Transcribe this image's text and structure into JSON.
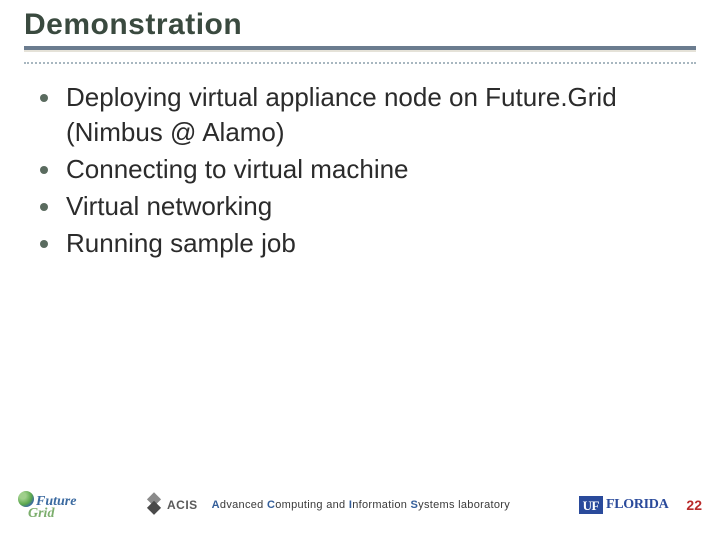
{
  "title": "Demonstration",
  "bullets": [
    "Deploying virtual appliance node on Future.Grid (Nimbus @ Alamo)",
    "Connecting to virtual machine",
    "Virtual networking",
    "Running sample job"
  ],
  "footer": {
    "futuregrid": {
      "line1": "Future",
      "line2": "Grid"
    },
    "acis": "ACIS",
    "lab_prefix_A": "A",
    "lab_word1_rest": "dvanced ",
    "lab_prefix_C": "C",
    "lab_word2_rest": "omputing and ",
    "lab_prefix_I": "I",
    "lab_word3_rest": "nformation ",
    "lab_prefix_S": "S",
    "lab_word4_rest": "ystems laboratory",
    "uf_box": "UF",
    "uf_text": "FLORIDA",
    "page": "22"
  }
}
